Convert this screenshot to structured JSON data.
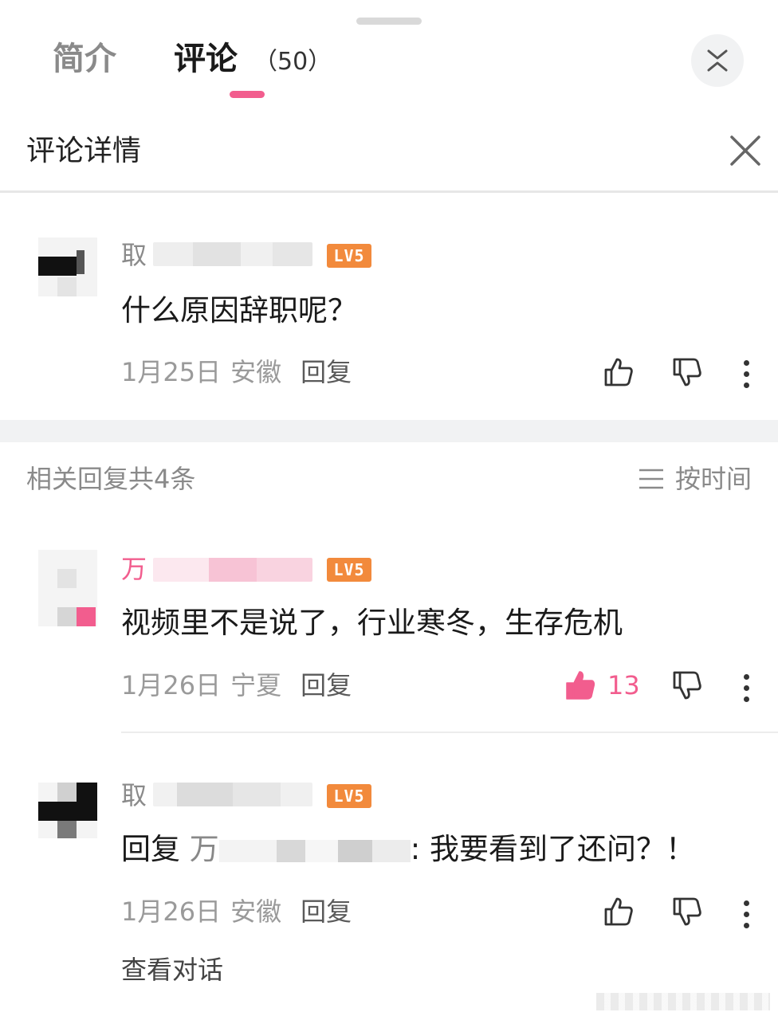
{
  "tabs": {
    "intro": "简介",
    "comments": "评论",
    "comment_count": "（50）"
  },
  "detail": {
    "title": "评论详情"
  },
  "main_comment": {
    "username_visible": "取",
    "level": "LV5",
    "text": "什么原因辞职呢？",
    "date": "1月25日",
    "location": "安徽",
    "reply_label": "回复"
  },
  "replies_header": {
    "count_label": "相关回复共4条",
    "sort_label": "按时间"
  },
  "replies": [
    {
      "username_visible": "万",
      "level": "LV5",
      "text": "视频里不是说了，行业寒冬，生存危机",
      "date": "1月26日",
      "location": "宁夏",
      "reply_label": "回复",
      "likes": "13"
    },
    {
      "username_visible": "取",
      "level": "LV5",
      "text_prefix": "回复 ",
      "text_mention_visible": "万",
      "text_body": ": 我要看到了还问？！",
      "date": "1月26日",
      "location": "安徽",
      "reply_label": "回复"
    }
  ],
  "view_conversation": "查看对话",
  "colors": {
    "accent": "#f25d8e",
    "level_badge": "#f28a3c"
  },
  "icons": [
    "chevron-collapse-icon",
    "close-icon",
    "thumbs-up-icon",
    "thumbs-down-icon",
    "more-vertical-icon",
    "sort-lines-icon"
  ]
}
